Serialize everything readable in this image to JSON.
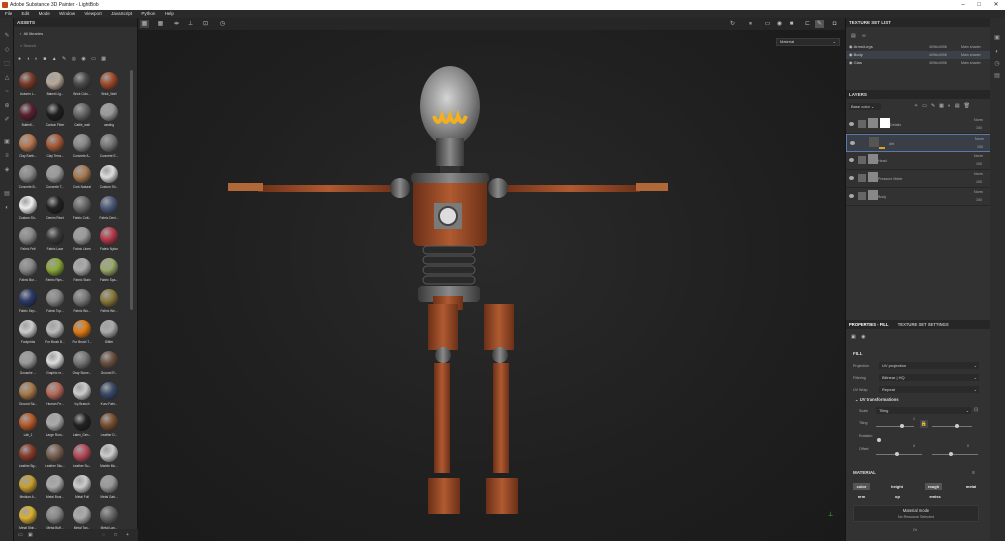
{
  "title": "Adobe Substance 3D Painter - LightBob",
  "menu": [
    "File",
    "Edit",
    "Mode",
    "Window",
    "Viewport",
    "JavaScript",
    "Python",
    "Help"
  ],
  "assets": {
    "header": "ASSETS",
    "library": "All libraries",
    "search_placeholder": "Search",
    "materials": [
      {
        "label": "Autumn L...",
        "color": "#7a3a28"
      },
      {
        "label": "Baked Lig...",
        "color": "#b8a898"
      },
      {
        "label": "Brick Colo...",
        "color": "#4a4a4a"
      },
      {
        "label": "Brick_Wall",
        "color": "#a04a2a"
      },
      {
        "label": "Butterfl...",
        "color": "#5a2030"
      },
      {
        "label": "Carbon Fiber",
        "color": "#1e1e1e"
      },
      {
        "label": "Cattle_wall",
        "color": "#666"
      },
      {
        "label": "casting",
        "color": "#999"
      },
      {
        "label": "Clay Earth...",
        "color": "#b87850"
      },
      {
        "label": "Clay Terra...",
        "color": "#a85a38"
      },
      {
        "label": "Concrete A...",
        "color": "#888"
      },
      {
        "label": "Concrete E...",
        "color": "#777"
      },
      {
        "label": "Concrete B...",
        "color": "#8a8a8a"
      },
      {
        "label": "Concrete T...",
        "color": "#999"
      },
      {
        "label": "Cork Natural",
        "color": "#a87a50"
      },
      {
        "label": "Custom Sh...",
        "color": "#ddd"
      },
      {
        "label": "Custom Sh...",
        "color": "#eee"
      },
      {
        "label": "Denim Rivet",
        "color": "#222"
      },
      {
        "label": "Fabric Cott...",
        "color": "#6a6a6a"
      },
      {
        "label": "Fabric Deni...",
        "color": "#4a5a7a"
      },
      {
        "label": "Fabric Felt",
        "color": "#8a8a8a"
      },
      {
        "label": "Fabric Lace",
        "color": "#3a3a3a"
      },
      {
        "label": "Fabric Linen",
        "color": "#9a9a9a"
      },
      {
        "label": "Fabric Nylon",
        "color": "#b83a4a"
      },
      {
        "label": "Fabric Bur...",
        "color": "#888"
      },
      {
        "label": "Fabric Rips...",
        "color": "#8aa838"
      },
      {
        "label": "Fabric Stain",
        "color": "#aaa"
      },
      {
        "label": "Fabric Spa...",
        "color": "#9aaa6a"
      },
      {
        "label": "Fabric Sep...",
        "color": "#2a3a6a"
      },
      {
        "label": "Fabric Top...",
        "color": "#888"
      },
      {
        "label": "Fabric Wo...",
        "color": "#7a7a7a"
      },
      {
        "label": "Fabric We...",
        "color": "#8a7a3a"
      },
      {
        "label": "Footprints",
        "color": "#ccc"
      },
      {
        "label": "Fur Brush B...",
        "color": "#bbb"
      },
      {
        "label": "Fur Brush T...",
        "color": "#e07a10"
      },
      {
        "label": "Glitter",
        "color": "#aaa"
      },
      {
        "label": "Gouache ...",
        "color": "#999"
      },
      {
        "label": "Graphic re...",
        "color": "#ddd"
      },
      {
        "label": "Gray Stone...",
        "color": "#777"
      },
      {
        "label": "Ground R...",
        "color": "#6a5040"
      },
      {
        "label": "Ground Sa...",
        "color": "#a87a4a"
      },
      {
        "label": "Human Fe...",
        "color": "#b86a5a"
      },
      {
        "label": "Ivy Branch",
        "color": "#ccc"
      },
      {
        "label": "Kuru Fabr...",
        "color": "#3a4a6a"
      },
      {
        "label": "Lab_1",
        "color": "#b85a2a"
      },
      {
        "label": "Large Rum...",
        "color": "#aaa"
      },
      {
        "label": "Latex_Gen...",
        "color": "#222"
      },
      {
        "label": "Leather D...",
        "color": "#7a5030"
      },
      {
        "label": "Leather Bg...",
        "color": "#8a3a2a"
      },
      {
        "label": "Leather Sku...",
        "color": "#7a6050"
      },
      {
        "label": "Leather Su...",
        "color": "#b84a5a"
      },
      {
        "label": "Marble Mo...",
        "color": "#ccc"
      },
      {
        "label": "Medium A...",
        "color": "#c8a030"
      },
      {
        "label": "Metal Brus...",
        "color": "#aaa"
      },
      {
        "label": "Metal Foil",
        "color": "#ccc"
      },
      {
        "label": "Metal Gab...",
        "color": "#999"
      },
      {
        "label": "Metal Shin...",
        "color": "#d8b030"
      },
      {
        "label": "Metal Buff...",
        "color": "#888"
      },
      {
        "label": "Metal Tan...",
        "color": "#aaa"
      },
      {
        "label": "Metal Lan...",
        "color": "#666"
      }
    ]
  },
  "viewport": {
    "material_select": "Material"
  },
  "texture_set_list": {
    "header": "TEXTURE SET LIST",
    "rows": [
      {
        "name": "Arms/Legs",
        "size": "4096x4096",
        "shader": "Main shader"
      },
      {
        "name": "Body",
        "size": "4096x4096",
        "shader": "Main shader"
      },
      {
        "name": "Glas",
        "size": "4096x4096",
        "shader": "Main shader"
      }
    ]
  },
  "layers": {
    "header": "LAYERS",
    "channel": "Base color",
    "rows": [
      {
        "name": "Details",
        "blend": "Norm",
        "opacity": "100"
      },
      {
        "name": "dirt",
        "blend": "Norm",
        "opacity": "100"
      },
      {
        "name": "Head",
        "blend": "Norm",
        "opacity": "100"
      },
      {
        "name": "Pressure Meter",
        "blend": "Norm",
        "opacity": "100"
      },
      {
        "name": "Body",
        "blend": "Norm",
        "opacity": "100"
      }
    ]
  },
  "properties": {
    "tab_fill": "PROPERTIES - FILL",
    "tab_tss": "TEXTURE SET SETTINGS",
    "fill": "FILL",
    "projection_label": "Projection",
    "projection": "UV projection",
    "filtering_label": "Filtering",
    "filtering": "Bilinear | HQ",
    "uvwrap_label": "UV Wrap",
    "uvwrap": "Repeat",
    "uvtrans": "UV transformations",
    "scale_label": "Scale",
    "scale": "Tiling",
    "tiling_label": "Tiling",
    "tiling_val": "1",
    "rotation_label": "Rotation",
    "offset_label": "Offset",
    "offset_val": "0",
    "material": "MATERIAL",
    "channels": [
      "color",
      "height",
      "rough",
      "metal",
      "nrm",
      "op",
      "emiss"
    ],
    "matmode": "Material mode",
    "matmode_sub": "No Resource Selected",
    "or": "Or"
  }
}
